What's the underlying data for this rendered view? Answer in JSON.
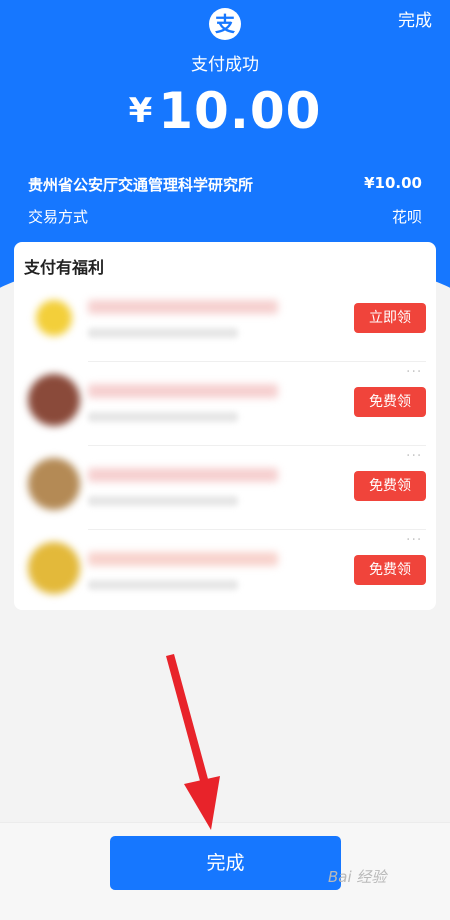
{
  "header": {
    "done_label": "完成",
    "logo_glyph": "支",
    "status": "支付成功",
    "currency": "¥",
    "amount": "10.00"
  },
  "details": {
    "merchant": "贵州省公安厅交通管理科学研究所",
    "merchant_amount": "¥10.00",
    "method_label": "交易方式",
    "method_value": "花呗"
  },
  "benefits": {
    "title": "支付有福利",
    "items": [
      {
        "action": "立即领",
        "thumb_color": "#f3cf3a",
        "title_color": "#f6d0cf"
      },
      {
        "action": "免费领",
        "thumb_color": "#8a4a3a",
        "title_color": "#f6cfcf"
      },
      {
        "action": "免费领",
        "thumb_color": "#b48a55",
        "title_color": "#f6cfcf"
      },
      {
        "action": "免费领",
        "thumb_color": "#e3b93a",
        "title_color": "#f8d2cc"
      }
    ]
  },
  "footer": {
    "done_button": "完成",
    "watermark": "Bai 经验"
  },
  "colors": {
    "brand_blue": "#1677ff",
    "action_red": "#f0443b",
    "arrow_red": "#e8232a"
  }
}
